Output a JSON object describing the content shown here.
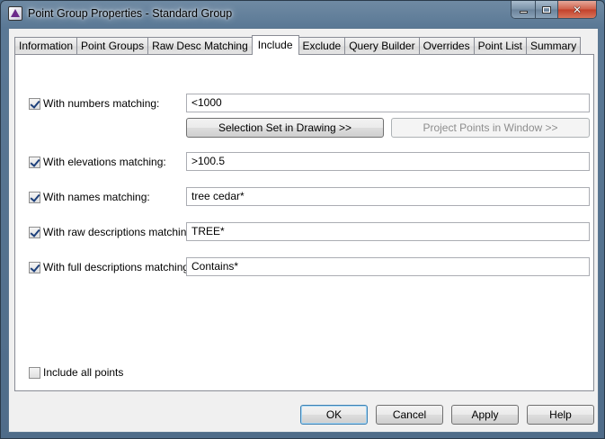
{
  "window": {
    "title": "Point Group Properties - Standard Group",
    "controls": {
      "minimize_icon": "minimize-icon",
      "maximize_icon": "maximize-icon",
      "close_icon": "close-icon",
      "close_glyph": "✕"
    }
  },
  "tabs": [
    {
      "label": "Information",
      "active": false
    },
    {
      "label": "Point Groups",
      "active": false
    },
    {
      "label": "Raw Desc Matching",
      "active": false
    },
    {
      "label": "Include",
      "active": true
    },
    {
      "label": "Exclude",
      "active": false
    },
    {
      "label": "Query Builder",
      "active": false
    },
    {
      "label": "Overrides",
      "active": false
    },
    {
      "label": "Point List",
      "active": false
    },
    {
      "label": "Summary",
      "active": false
    }
  ],
  "include": {
    "numbers": {
      "label": "With numbers matching:",
      "checked": true,
      "value": "<1000"
    },
    "selection_set_button": "Selection Set in Drawing >>",
    "project_points_button": "Project Points in Window >>",
    "elevations": {
      "label": "With elevations matching:",
      "checked": true,
      "value": ">100.5"
    },
    "names": {
      "label": "With names matching:",
      "checked": true,
      "value": "tree cedar*"
    },
    "raw_descriptions": {
      "label": "With raw descriptions matching:",
      "checked": true,
      "value": "TREE*"
    },
    "full_descriptions": {
      "label": "With full descriptions matching:",
      "checked": true,
      "value": "Contains*"
    },
    "include_all": {
      "label": "Include all points",
      "checked": false
    }
  },
  "footer": {
    "ok": "OK",
    "cancel": "Cancel",
    "apply": "Apply",
    "help": "Help"
  },
  "colors": {
    "titlebar": "#5a7895",
    "close_button": "#c2402a",
    "dialog_bg": "#f0f0f0",
    "panel_bg": "#ffffff"
  }
}
